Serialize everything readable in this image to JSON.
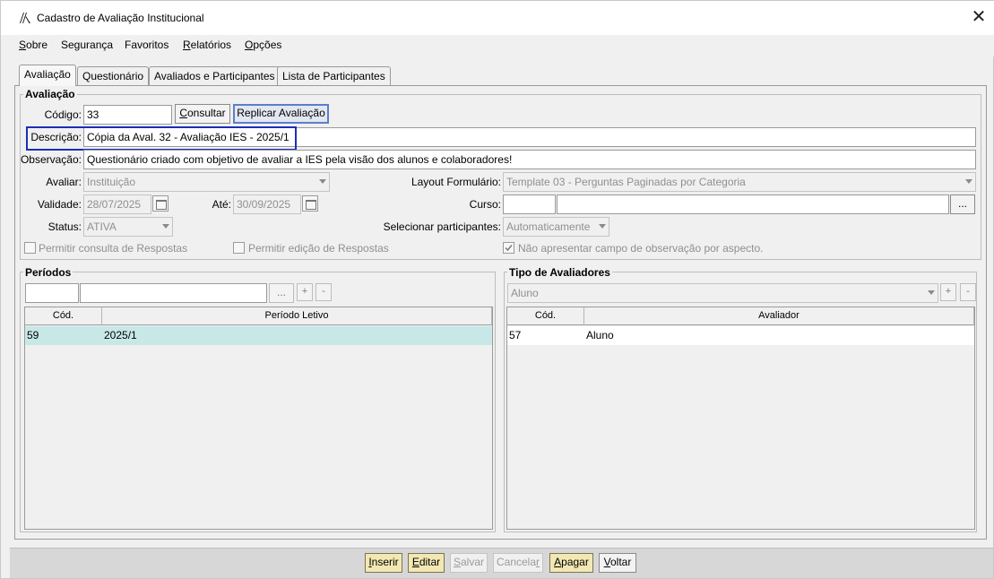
{
  "window": {
    "title": "Cadastro de Avaliação Institucional",
    "close_icon": "close-icon"
  },
  "menu": [
    {
      "accel": "S",
      "rest": "obre"
    },
    {
      "accel": "",
      "rest": "Segurança"
    },
    {
      "accel": "",
      "rest": "Favoritos"
    },
    {
      "accel": "R",
      "rest": "elatórios"
    },
    {
      "accel": "O",
      "rest": "pções"
    }
  ],
  "tabs": [
    "Avaliação",
    "Questionário",
    "Avaliados e Participantes",
    "Lista de Participantes"
  ],
  "form": {
    "group_title": "Avaliação",
    "codigo_label": "Código:",
    "codigo_value": "33",
    "consultar_prefix": "C",
    "consultar_rest": "onsultar",
    "replicar_label": "Replicar Avaliação",
    "descricao_label": "Descrição:",
    "descricao_value": "Cópia da Aval. 32 - Avaliação IES - 2025/1",
    "observacao_label": "Observação:",
    "observacao_value": "Questionário criado com objetivo de avaliar a IES pela visão dos alunos e colaboradores!",
    "avaliar_label": "Avaliar:",
    "avaliar_value": "Instituição",
    "layout_label": "Layout Formulário:",
    "layout_value": "Template 03 - Perguntas Paginadas por Categoria",
    "validade_label": "Validade:",
    "validade_value": "28/07/2025",
    "ate_label": "Até:",
    "ate_value": "30/09/2025",
    "curso_label": "Curso:",
    "curso_code": "",
    "curso_name": "",
    "curso_ellipsis": "...",
    "status_label": "Status:",
    "status_value": "ATIVA",
    "selecionar_label": "Selecionar participantes:",
    "selecionar_value": "Automaticamente",
    "check_consulta": "Permitir consulta de Respostas",
    "check_edicao": "Permitir edição de Respostas",
    "check_observacao": "Não apresentar campo de observação por aspecto.",
    "check_observacao_checked": true
  },
  "periodos": {
    "title": "Períodos",
    "ellipsis": "...",
    "add": "+",
    "remove": "-",
    "columns": [
      "Cód.",
      "Período Letivo"
    ],
    "rows": [
      {
        "cod": "59",
        "periodo": "2025/1"
      }
    ]
  },
  "avaliadores": {
    "title": "Tipo de Avaliadores",
    "combo_value": "Aluno",
    "add": "+",
    "remove": "-",
    "columns": [
      "Cód.",
      "Avaliador"
    ],
    "rows": [
      {
        "cod": "57",
        "avaliador": "Aluno"
      }
    ]
  },
  "actions": {
    "inserir": {
      "accel": "I",
      "rest": "nserir"
    },
    "editar": {
      "accel": "E",
      "rest": "ditar"
    },
    "salvar": {
      "accel": "S",
      "rest": "alvar"
    },
    "cancelar_a": "Cancela",
    "cancelar_accel": "r",
    "apagar": {
      "accel": "A",
      "rest": "pagar"
    },
    "voltar": {
      "accel": "V",
      "rest": "oltar"
    }
  },
  "colors": {
    "highlight_border": "#1a2fb8",
    "selected_row": "#c8e8e8",
    "action_button": "#f2e8b3",
    "replicar_border": "#5b7fc9"
  }
}
